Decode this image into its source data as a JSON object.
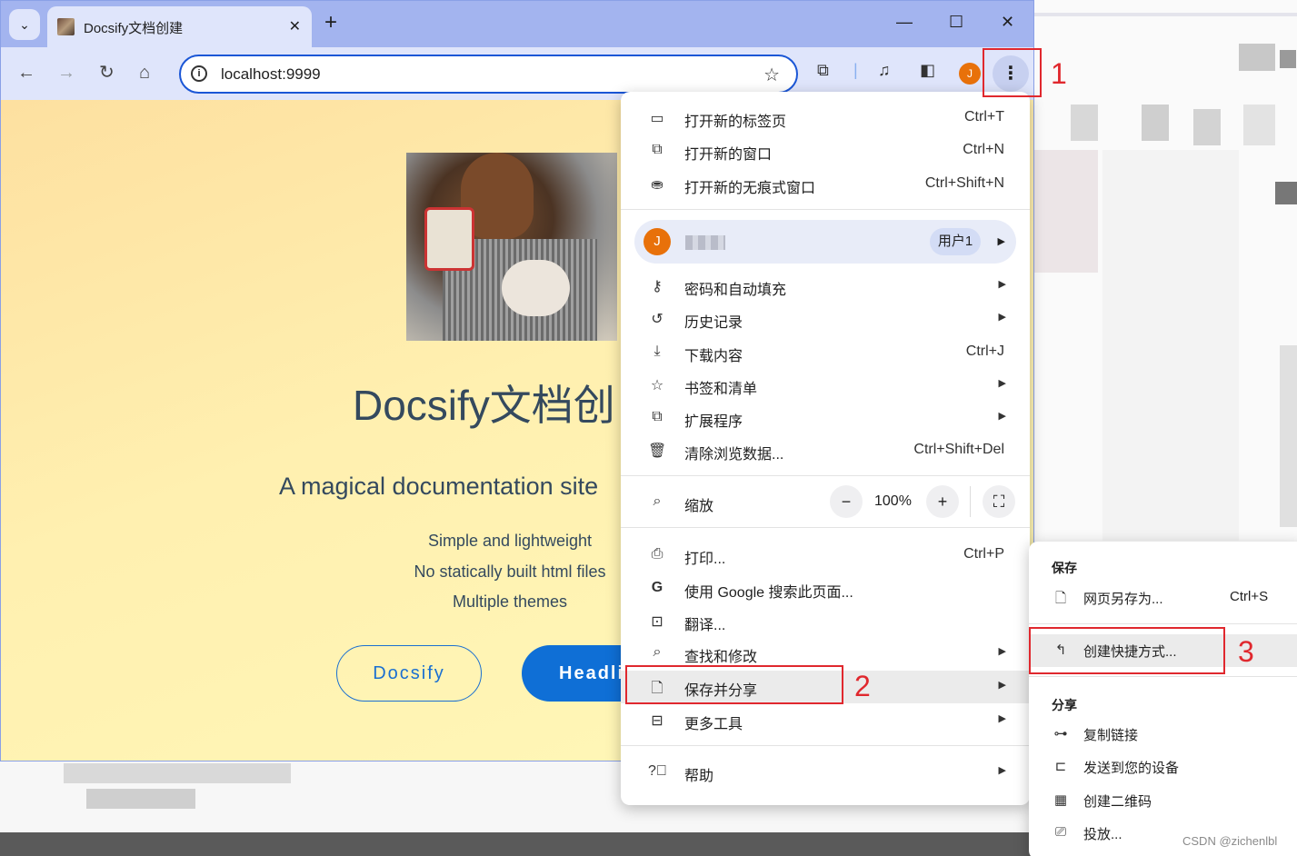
{
  "browser": {
    "tab_title": "Docsify文档创建",
    "tab_close": "✕",
    "new_tab": "+",
    "url": "localhost:9999",
    "profile_initial": "J"
  },
  "page": {
    "title": "Docsify文档创",
    "subtitle": "A magical documentation site",
    "features": [
      "Simple and lightweight",
      "No statically built html files",
      "Multiple themes"
    ],
    "btn_docsify": "Docsify",
    "btn_headline": "Headli"
  },
  "menu": {
    "new_tab": {
      "label": "打开新的标签页",
      "shortcut": "Ctrl+T"
    },
    "new_window": {
      "label": "打开新的窗口",
      "shortcut": "Ctrl+N"
    },
    "incognito": {
      "label": "打开新的无痕式窗口",
      "shortcut": "Ctrl+Shift+N"
    },
    "profile": {
      "initial": "J",
      "badge": "用户1"
    },
    "passwords": {
      "label": "密码和自动填充"
    },
    "history": {
      "label": "历史记录"
    },
    "downloads": {
      "label": "下载内容",
      "shortcut": "Ctrl+J"
    },
    "bookmarks": {
      "label": "书签和清单"
    },
    "extensions": {
      "label": "扩展程序"
    },
    "clear_data": {
      "label": "清除浏览数据...",
      "shortcut": "Ctrl+Shift+Del"
    },
    "zoom": {
      "label": "缩放",
      "minus": "−",
      "value": "100%",
      "plus": "+"
    },
    "print": {
      "label": "打印...",
      "shortcut": "Ctrl+P"
    },
    "google_search": {
      "label": "使用 Google 搜索此页面..."
    },
    "translate": {
      "label": "翻译..."
    },
    "find_edit": {
      "label": "查找和修改"
    },
    "save_share": {
      "label": "保存并分享"
    },
    "more_tools": {
      "label": "更多工具"
    },
    "help": {
      "label": "帮助"
    }
  },
  "submenu": {
    "save_header": "保存",
    "save_as": {
      "label": "网页另存为...",
      "shortcut": "Ctrl+S"
    },
    "create_shortcut": {
      "label": "创建快捷方式..."
    },
    "share_header": "分享",
    "copy_link": {
      "label": "复制链接"
    },
    "send_device": {
      "label": "发送到您的设备"
    },
    "qr_code": {
      "label": "创建二维码"
    },
    "cast": {
      "label": "投放..."
    }
  },
  "annotations": [
    "1",
    "2",
    "3"
  ],
  "watermark": "CSDN @zichenlbl",
  "colors": {
    "accent": "#1a56d6",
    "annotation_red": "#e0282e",
    "profile_orange": "#e8710a"
  }
}
